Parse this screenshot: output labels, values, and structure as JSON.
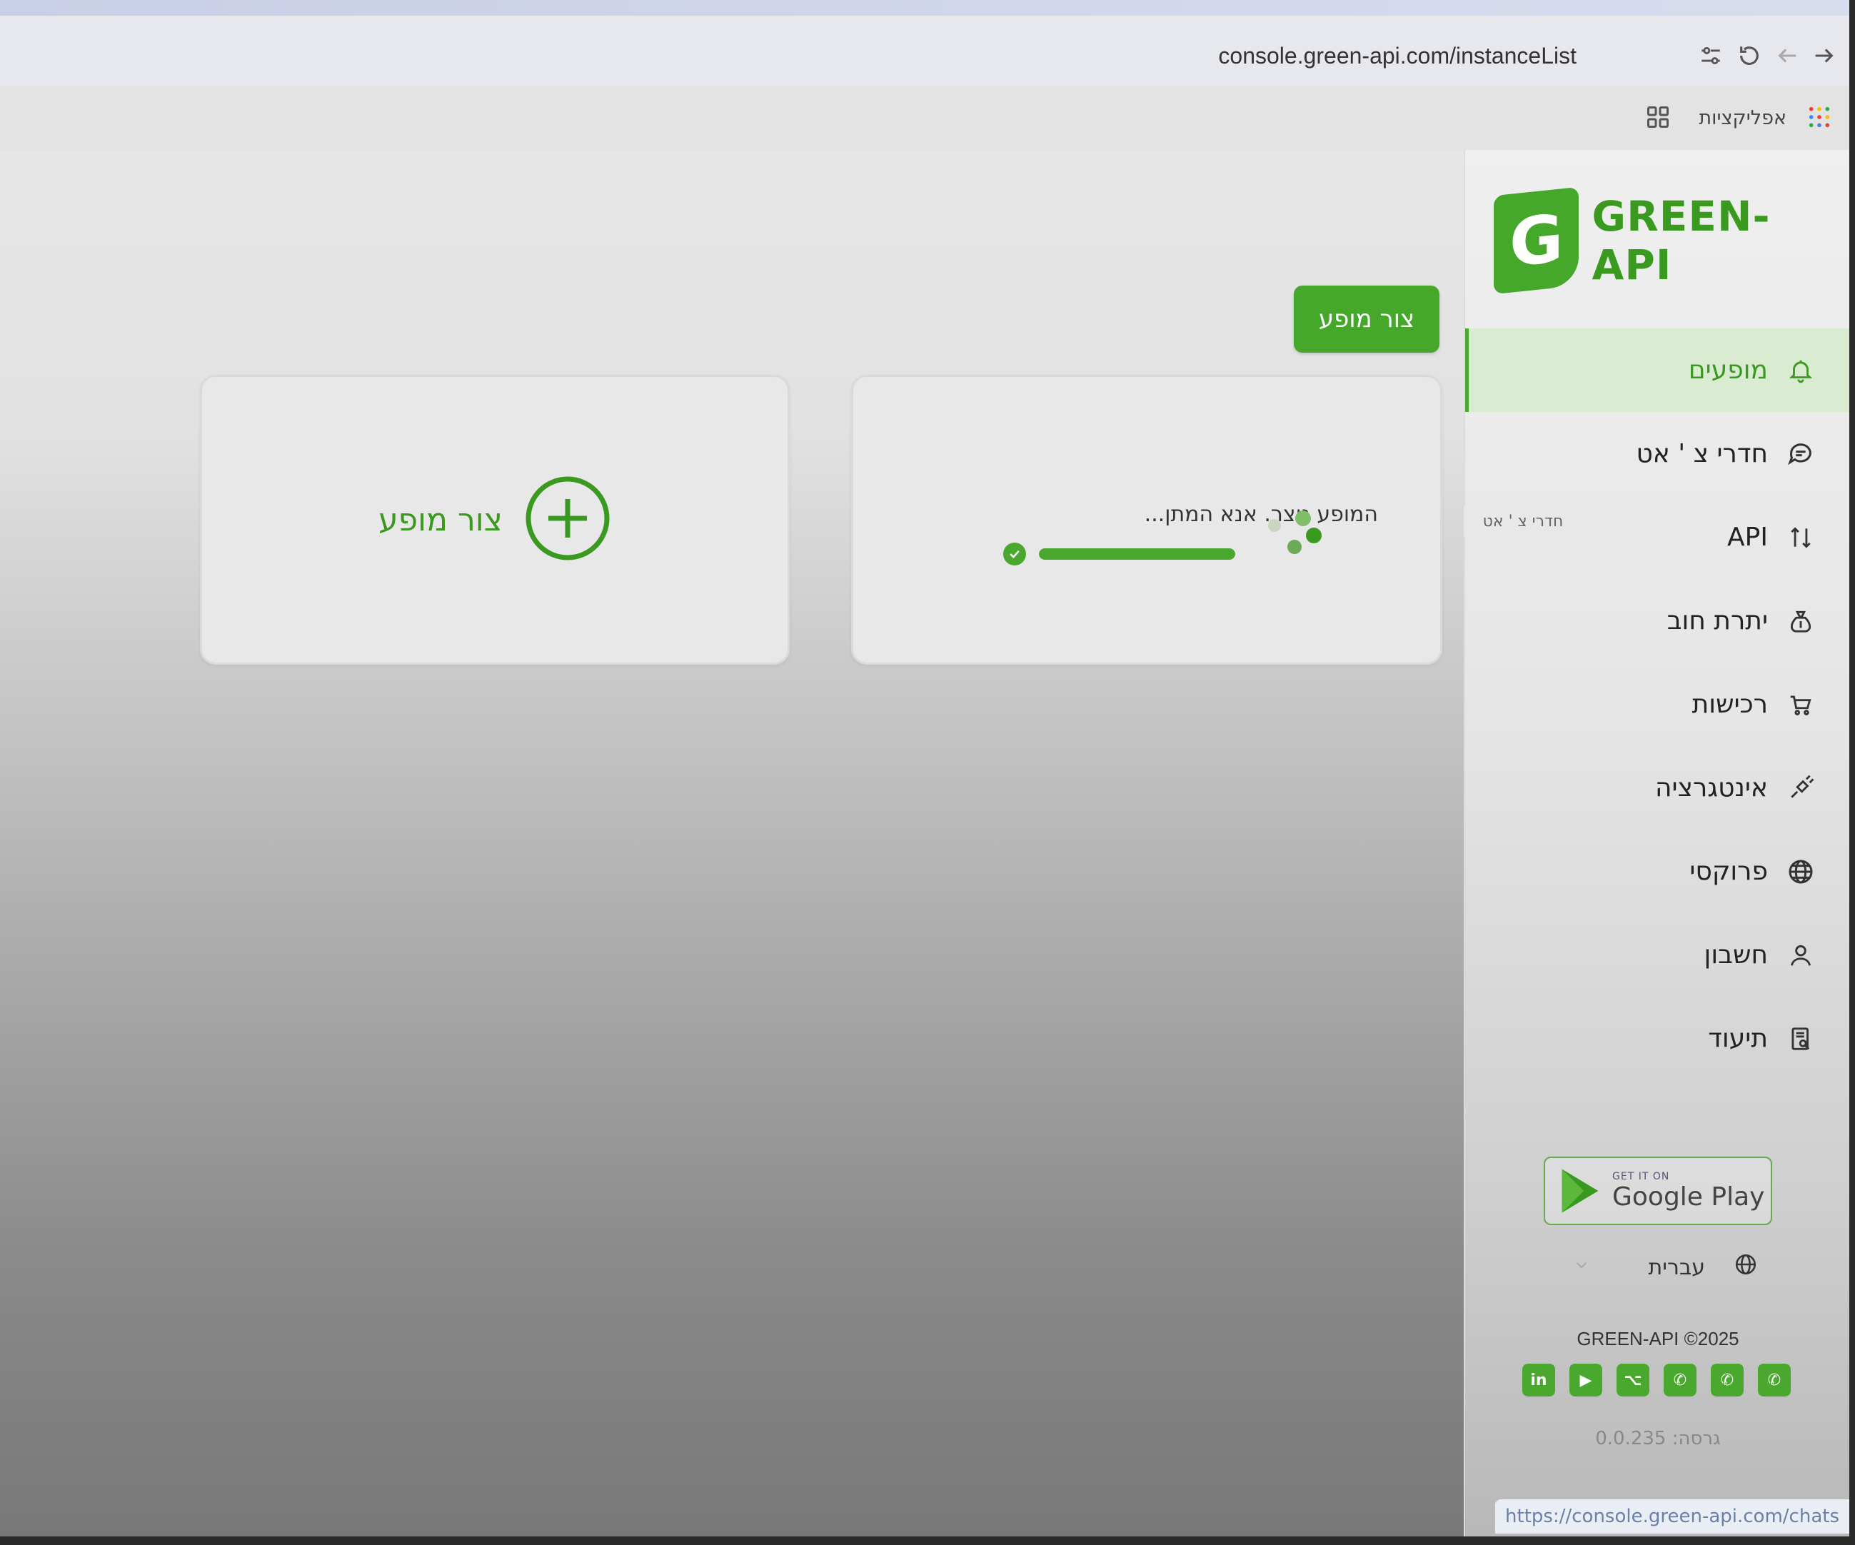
{
  "browser": {
    "url": "console.green-api.com/instanceList",
    "apps_label": "אפליקציות"
  },
  "brand": {
    "logo_letter": "G",
    "name": "GREEN-API",
    "accent": "#45a82a"
  },
  "nav": {
    "items": [
      {
        "label": "מופעים",
        "icon": "bell-icon",
        "active": true
      },
      {
        "label": "חדרי צ ' אט",
        "icon": "chat-icon",
        "active": false
      },
      {
        "label": "API",
        "icon": "api-icon",
        "active": false
      },
      {
        "label": "יתרת חוב",
        "icon": "money-bag-icon",
        "active": false
      },
      {
        "label": "רכישות",
        "icon": "cart-icon",
        "active": false
      },
      {
        "label": "אינטגרציה",
        "icon": "integration-icon",
        "active": false
      },
      {
        "label": "פרוקסי",
        "icon": "globe-icon",
        "active": false
      },
      {
        "label": "חשבון",
        "icon": "user-icon",
        "active": false
      },
      {
        "label": "תיעוד",
        "icon": "docs-icon",
        "active": false
      }
    ],
    "tooltip": "חדרי צ ' אט"
  },
  "google_play": {
    "small": "GET IT ON",
    "big": "Google Play"
  },
  "language": {
    "selected": "עברית"
  },
  "footer": {
    "copyright": "GREEN-API ©2025",
    "version": "גרסה: 0.0.235",
    "socials": [
      "linkedin-icon",
      "youtube-icon",
      "github-icon",
      "whatsapp-icon",
      "whatsapp-icon",
      "whatsapp-icon"
    ],
    "social_labels": [
      "in",
      "▶",
      "⌥",
      "✆",
      "✆",
      "✆"
    ]
  },
  "status_bar_url": "https://console.green-api.com/chats",
  "main": {
    "create_button_label": "צור מופע",
    "add_card_label": "צור מופע",
    "loading_text": "המופע נוצר. אנא המתן...",
    "progress": 1.0
  }
}
